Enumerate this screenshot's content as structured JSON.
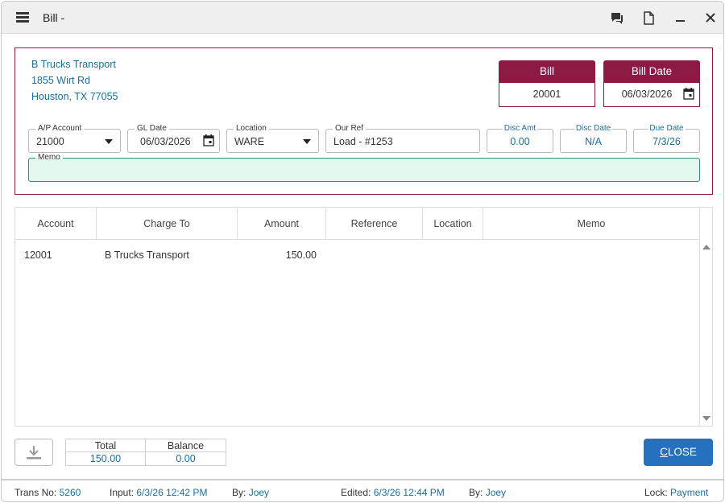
{
  "window": {
    "title": "Bill -"
  },
  "titlebar_icons": [
    "chat-icon",
    "document-icon",
    "minimize-icon",
    "close-icon"
  ],
  "vendor": {
    "name": "B Trucks Transport",
    "address1": "1855 Wirt Rd",
    "address2": "Houston, TX 77055"
  },
  "bill": {
    "label": "Bill",
    "value": "20001"
  },
  "bill_date": {
    "label": "Bill Date",
    "value": "06/03/2026"
  },
  "fields": {
    "ap_account": {
      "label": "A/P Account",
      "value": "21000"
    },
    "gl_date": {
      "label": "GL Date",
      "value": "06/03/2026"
    },
    "location": {
      "label": "Location",
      "value": "WARE"
    },
    "our_ref": {
      "label": "Our Ref",
      "value": "Load - #1253"
    },
    "disc_amt": {
      "label": "Disc Amt",
      "value": "0.00"
    },
    "disc_date": {
      "label": "Disc Date",
      "value": "N/A"
    },
    "due_date": {
      "label": "Due Date",
      "value": "7/3/26"
    },
    "memo": {
      "label": "Memo",
      "value": ""
    }
  },
  "grid": {
    "columns": [
      "Account",
      "Charge To",
      "Amount",
      "Reference",
      "Location",
      "Memo"
    ],
    "rows": [
      {
        "account": "12001",
        "charge_to": "B Trucks Transport",
        "amount": "150.00",
        "reference": "",
        "location": "",
        "memo": ""
      }
    ]
  },
  "totals": {
    "total_label": "Total",
    "total_value": "150.00",
    "balance_label": "Balance",
    "balance_value": "0.00"
  },
  "actions": {
    "close_label_underlined": "C",
    "close_label_rest": "LOSE"
  },
  "status": {
    "trans_no_label": "Trans No:",
    "trans_no": "5260",
    "input_label": "Input:",
    "input_value": "6/3/26 12:42 PM",
    "by1_label": "By:",
    "by1_value": "Joey",
    "edited_label": "Edited:",
    "edited_value": "6/3/26 12:44 PM",
    "by2_label": "By:",
    "by2_value": "Joey",
    "lock_label": "Lock:",
    "lock_value": "Payment"
  },
  "colors": {
    "accent": "#8d1a45",
    "link": "#1a6e9c",
    "primary_button": "#2670c0",
    "memo_bg": "#e3f7ef"
  }
}
